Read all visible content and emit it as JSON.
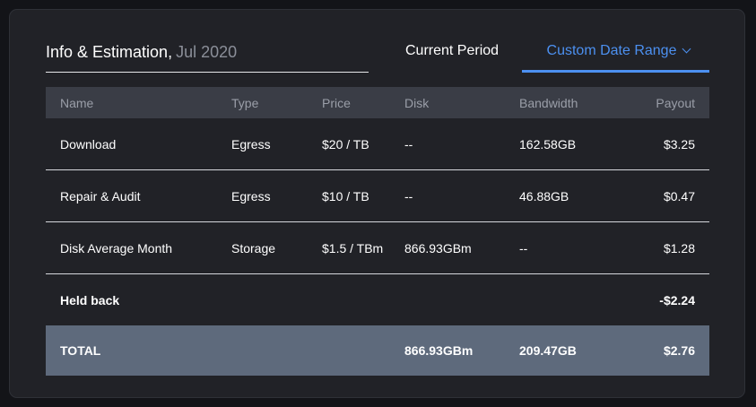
{
  "header": {
    "title": "Info & Estimation,",
    "period": "Jul 2020",
    "tab_current": "Current Period",
    "tab_custom": "Custom Date Range"
  },
  "table": {
    "columns": [
      "Name",
      "Type",
      "Price",
      "Disk",
      "Bandwidth",
      "Payout"
    ],
    "rows": [
      {
        "name": "Download",
        "type": "Egress",
        "price": "$20 / TB",
        "disk": "--",
        "bandwidth": "162.58GB",
        "payout": "$3.25"
      },
      {
        "name": "Repair & Audit",
        "type": "Egress",
        "price": "$10 / TB",
        "disk": "--",
        "bandwidth": "46.88GB",
        "payout": "$0.47"
      },
      {
        "name": "Disk Average Month",
        "type": "Storage",
        "price": "$1.5 / TBm",
        "disk": "866.93GBm",
        "bandwidth": "--",
        "payout": "$1.28"
      }
    ],
    "held": {
      "label": "Held back",
      "payout": "-$2.24"
    },
    "total": {
      "label": "TOTAL",
      "disk": "866.93GBm",
      "bandwidth": "209.47GB",
      "payout": "$2.76"
    }
  },
  "colors": {
    "accent": "#4c90f0",
    "card": "#212227",
    "header_row": "#3a3d46",
    "total_row": "#5e6a7c"
  }
}
